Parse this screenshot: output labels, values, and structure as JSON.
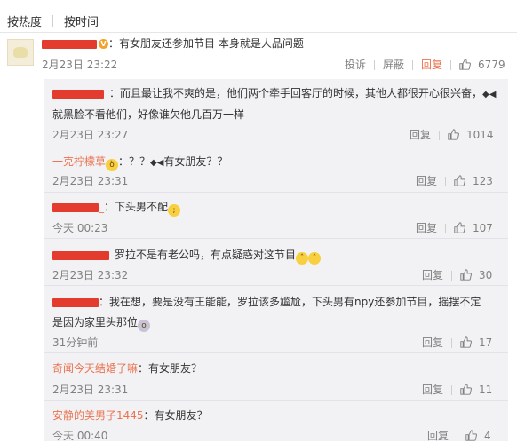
{
  "tabs": {
    "hot": "按热度",
    "time": "按时间"
  },
  "main_comment": {
    "separator": "：",
    "text": "有女朋友还参加节目 本身就是人品问题",
    "time": "2月23日 23:22",
    "report": "投诉",
    "block": "屏蔽",
    "reply": "回复",
    "likes": "6779"
  },
  "replies": [
    {
      "user_suffix": "_",
      "text1": "：而且最让我不爽的是，他们两个牵手回客厅的时候，其他人都很开心很兴奋，",
      "text2": "就黑脸不看他们，好像谁欠他几百万一样",
      "time": "2月23日 23:27",
      "reply": "回复",
      "likes": "1014"
    },
    {
      "user": "一克柠檬草",
      "text": "：？？",
      "text_b": "有女朋友？？",
      "time": "2月23日 23:31",
      "reply": "回复",
      "likes": "123"
    },
    {
      "user_suffix": "_",
      "text": "：下头男不配",
      "time": "今天 00:23",
      "reply": "回复",
      "likes": "107"
    },
    {
      "text": "罗拉不是有老公吗，有点疑惑对这节目",
      "time": "2月23日 23:32",
      "reply": "回复",
      "likes": "30"
    },
    {
      "text1": "：我在想，要是没有王能能，罗拉该多尴尬，下头男有npy还参加节目，摇摆不定",
      "text2": "是因为家里头那位",
      "time": "31分钟前",
      "reply": "回复",
      "likes": "17"
    },
    {
      "user": "奇闻今天结婚了嘛",
      "text": "：有女朋友？",
      "time": "2月23日 23:31",
      "reply": "回复",
      "likes": "11"
    },
    {
      "user": "安静的美男子1445",
      "text": "：有女朋友？",
      "time": "今天 00:40",
      "reply": "回复",
      "likes": "4"
    }
  ],
  "colors": {
    "accent": "#eb7350",
    "redaction": "#e33b2d",
    "muted": "#808080",
    "reply_bg": "#f2f2f5"
  }
}
